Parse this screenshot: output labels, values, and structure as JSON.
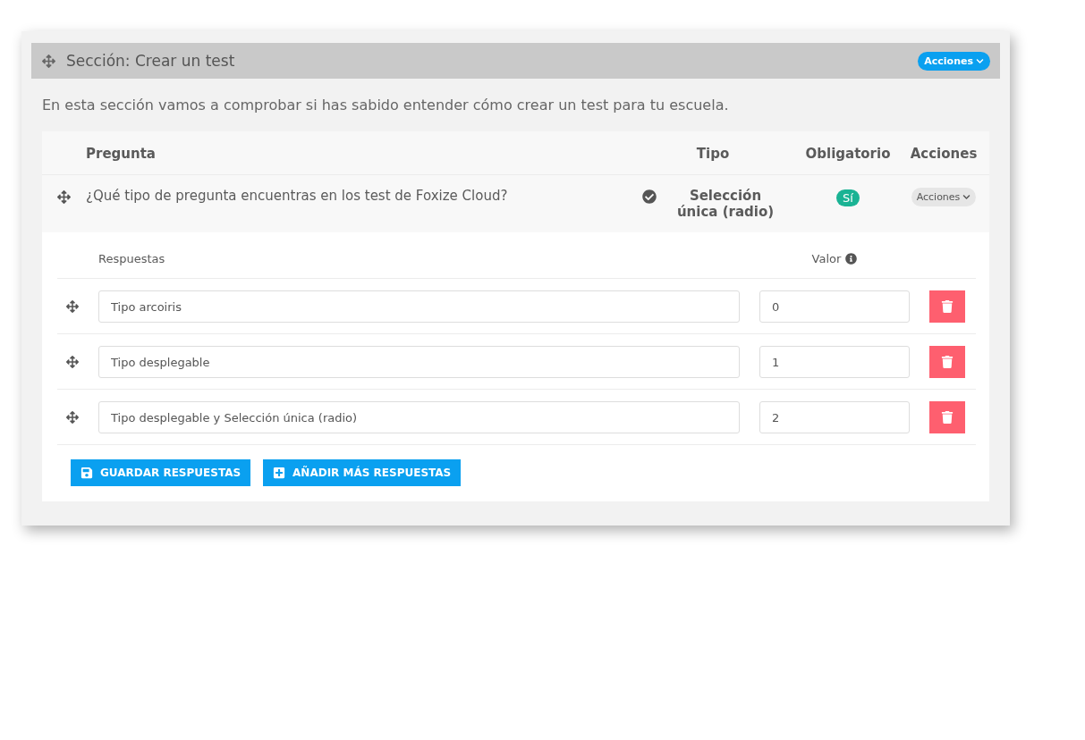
{
  "section": {
    "title": "Sección: Crear un test",
    "actions_label": "Acciones",
    "description": "En esta sección vamos a comprobar si has sabido entender cómo crear un test para tu escuela."
  },
  "questions_table": {
    "columns": [
      "Pregunta",
      "Tipo",
      "Obligatorio",
      "Acciones"
    ],
    "rows": [
      {
        "question": "¿Qué tipo de pregunta encuentras en los test de Foxize Cloud?",
        "type": "Selección única (radio)",
        "required": "Sí",
        "actions_label": "Acciones"
      }
    ]
  },
  "answers": {
    "columns": [
      "Respuestas",
      "Valor"
    ],
    "rows": [
      {
        "text": "Tipo arcoiris",
        "value": "0"
      },
      {
        "text": "Tipo desplegable",
        "value": "1"
      },
      {
        "text": "Tipo desplegable y Selección única (radio)",
        "value": "2"
      }
    ],
    "buttons": [
      {
        "kind": "save",
        "label": "GUARDAR RESPUESTAS"
      },
      {
        "kind": "add",
        "label": "AÑADIR MÁS RESPUESTAS"
      }
    ]
  }
}
